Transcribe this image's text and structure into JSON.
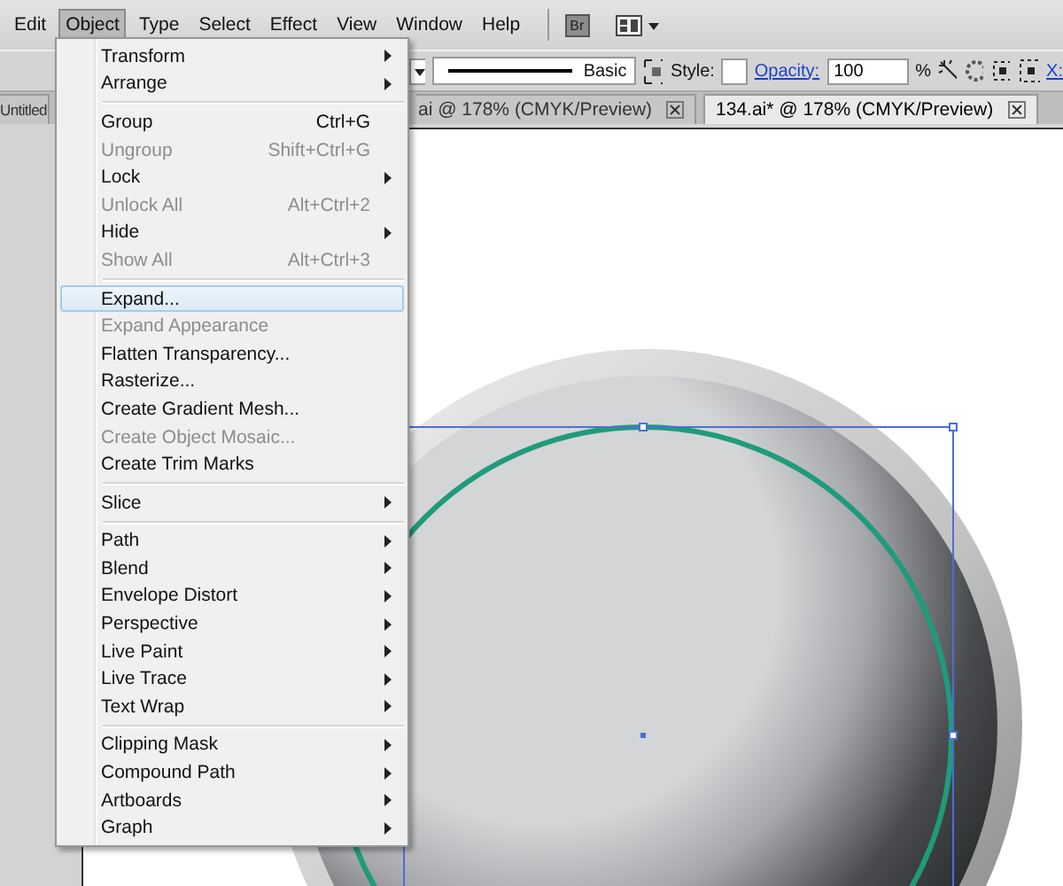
{
  "menu_bar": {
    "items": [
      {
        "label": "Edit",
        "selected": false
      },
      {
        "label": "Object",
        "selected": true
      },
      {
        "label": "Type",
        "selected": false
      },
      {
        "label": "Select",
        "selected": false
      },
      {
        "label": "Effect",
        "selected": false
      },
      {
        "label": "View",
        "selected": false
      },
      {
        "label": "Window",
        "selected": false
      },
      {
        "label": "Help",
        "selected": false
      }
    ],
    "bridge_button": "Br"
  },
  "control_bar": {
    "stroke_profile": "Basic",
    "style_label": "Style:",
    "opacity_label": "Opacity:",
    "opacity_value": "100",
    "opacity_unit": "%",
    "x_label": "X:"
  },
  "tabs": [
    {
      "label": "Untitled",
      "selected": false
    },
    {
      "label": "ai @ 178% (CMYK/Preview)",
      "selected": false
    },
    {
      "label": "134.ai* @ 178% (CMYK/Preview)",
      "selected": true
    }
  ],
  "object_menu": {
    "groups": [
      [
        {
          "label": "Transform",
          "submenu": true,
          "disabled": false,
          "selected": false
        },
        {
          "label": "Arrange",
          "submenu": true,
          "disabled": false,
          "selected": false
        }
      ],
      [
        {
          "label": "Group",
          "shortcut": "Ctrl+G",
          "submenu": false,
          "disabled": false,
          "selected": false
        },
        {
          "label": "Ungroup",
          "shortcut": "Shift+Ctrl+G",
          "submenu": false,
          "disabled": true,
          "selected": false
        },
        {
          "label": "Lock",
          "submenu": true,
          "disabled": false,
          "selected": false
        },
        {
          "label": "Unlock All",
          "shortcut": "Alt+Ctrl+2",
          "submenu": false,
          "disabled": true,
          "selected": false
        },
        {
          "label": "Hide",
          "submenu": true,
          "disabled": false,
          "selected": false
        },
        {
          "label": "Show All",
          "shortcut": "Alt+Ctrl+3",
          "submenu": false,
          "disabled": true,
          "selected": false
        }
      ],
      [
        {
          "label": "Expand...",
          "submenu": false,
          "disabled": false,
          "selected": true
        },
        {
          "label": "Expand Appearance",
          "submenu": false,
          "disabled": true,
          "selected": false
        },
        {
          "label": "Flatten Transparency...",
          "submenu": false,
          "disabled": false,
          "selected": false
        },
        {
          "label": "Rasterize...",
          "submenu": false,
          "disabled": false,
          "selected": false
        },
        {
          "label": "Create Gradient Mesh...",
          "submenu": false,
          "disabled": false,
          "selected": false
        },
        {
          "label": "Create Object Mosaic...",
          "submenu": false,
          "disabled": true,
          "selected": false
        },
        {
          "label": "Create Trim Marks",
          "submenu": false,
          "disabled": false,
          "selected": false
        }
      ],
      [
        {
          "label": "Slice",
          "submenu": true,
          "disabled": false,
          "selected": false
        }
      ],
      [
        {
          "label": "Path",
          "submenu": true,
          "disabled": false,
          "selected": false
        },
        {
          "label": "Blend",
          "submenu": true,
          "disabled": false,
          "selected": false
        },
        {
          "label": "Envelope Distort",
          "submenu": true,
          "disabled": false,
          "selected": false
        },
        {
          "label": "Perspective",
          "submenu": true,
          "disabled": false,
          "selected": false
        },
        {
          "label": "Live Paint",
          "submenu": true,
          "disabled": false,
          "selected": false
        },
        {
          "label": "Live Trace",
          "submenu": true,
          "disabled": false,
          "selected": false
        },
        {
          "label": "Text Wrap",
          "submenu": true,
          "disabled": false,
          "selected": false
        }
      ],
      [
        {
          "label": "Clipping Mask",
          "submenu": true,
          "disabled": false,
          "selected": false
        },
        {
          "label": "Compound Path",
          "submenu": true,
          "disabled": false,
          "selected": false
        },
        {
          "label": "Artboards",
          "submenu": true,
          "disabled": false,
          "selected": false
        },
        {
          "label": "Graph",
          "submenu": true,
          "disabled": false,
          "selected": false
        }
      ]
    ]
  }
}
